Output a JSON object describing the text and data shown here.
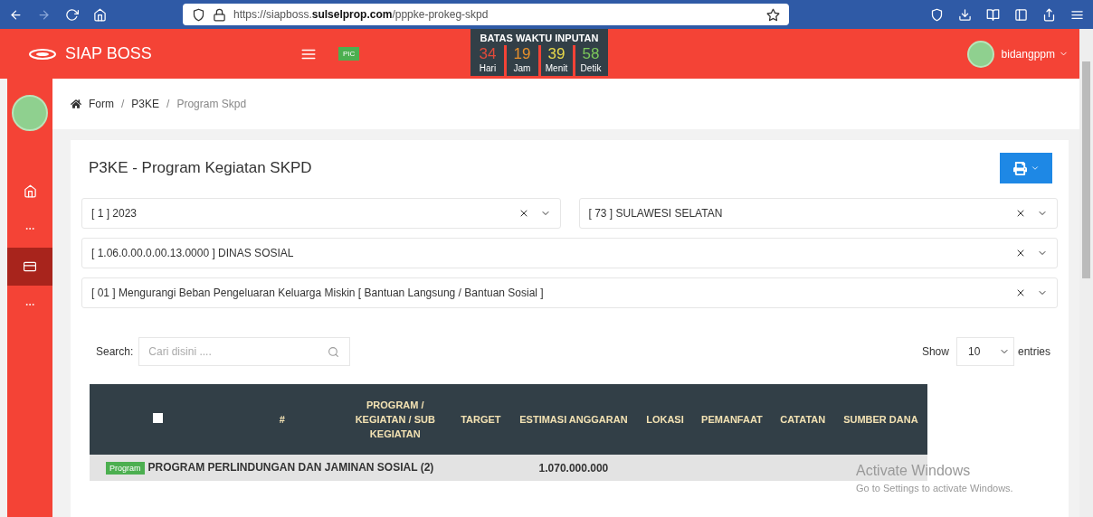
{
  "browser": {
    "url": "https://siapboss.**sulselprop.com**/pppke-prokeg-skpd"
  },
  "header": {
    "brand": "SIAP BOSS",
    "badge": "PIC",
    "user": "bidangppm"
  },
  "countdown": {
    "title": "BATAS WAKTU INPUTAN",
    "units": [
      {
        "value": "34",
        "label": "Hari",
        "color": "#e04a3a"
      },
      {
        "value": "19",
        "label": "Jam",
        "color": "#e8902a"
      },
      {
        "value": "39",
        "label": "Menit",
        "color": "#e8d84a"
      },
      {
        "value": "58",
        "label": "Detik",
        "color": "#7cc85a"
      }
    ]
  },
  "breadcrumb": [
    {
      "kind": "link",
      "label": "Form",
      "current": false
    },
    {
      "kind": "separator",
      "label": "/"
    },
    {
      "kind": "link",
      "label": "P3KE",
      "current": false
    },
    {
      "kind": "separator",
      "label": "/"
    },
    {
      "kind": "link",
      "label": "Program Skpd",
      "current": true
    }
  ],
  "sidebar": {
    "items": [
      {
        "kind": "home",
        "selected": false
      },
      {
        "kind": "dots",
        "selected": false
      },
      {
        "kind": "form",
        "selected": true
      },
      {
        "kind": "dots",
        "selected": false
      }
    ]
  },
  "card": {
    "title": "P3KE - Program Kegiatan SKPD",
    "filters": [
      [
        {
          "value": "[ 1 ] 2023"
        },
        {
          "value": "[ 73 ] SULAWESI SELATAN"
        }
      ],
      [
        {
          "value": "[ 1.06.0.00.0.00.13.0000 ] DINAS SOSIAL"
        }
      ],
      [
        {
          "value": "[ 01 ] Mengurangi Beban Pengeluaran Keluarga Miskin [ Bantuan Langsung / Bantuan Sosial ]"
        }
      ]
    ],
    "search": {
      "label": "Search:",
      "placeholder": "Cari disini ...."
    },
    "length": {
      "show": "Show",
      "value": "10",
      "entries": "entries"
    }
  },
  "table": {
    "select_all": {
      "checked": false
    },
    "columns": [
      "#",
      "PROGRAM / KEGIATAN / SUB KEGIATAN",
      "TARGET",
      "ESTIMASI ANGGARAN",
      "LOKASI",
      "PEMANFAAT",
      "CATATAN",
      "SUMBER DANA"
    ],
    "rows": [
      {
        "badge": "Program",
        "name": "PROGRAM PERLINDUNGAN DAN JAMINAN SOSIAL (2)",
        "estimasi": "1.070.000.000"
      }
    ]
  },
  "os_overlay": {
    "title": "Activate Windows",
    "subtitle": "Go to Settings to activate Windows."
  }
}
